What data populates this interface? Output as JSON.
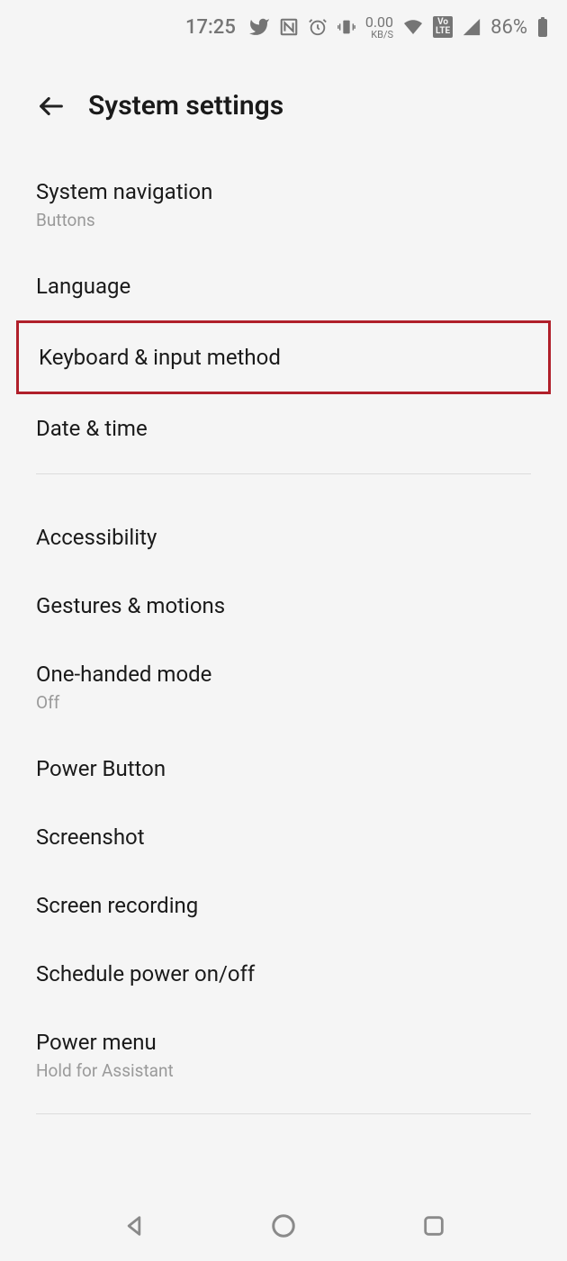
{
  "status": {
    "time": "17:25",
    "data_rate": "0.00",
    "data_unit": "KB/S",
    "battery_pct": "86%",
    "volte": "Vo\nLTE"
  },
  "header": {
    "title": "System settings"
  },
  "items": [
    {
      "title": "System navigation",
      "sub": "Buttons",
      "highlight": false
    },
    {
      "title": "Language",
      "sub": null,
      "highlight": false
    },
    {
      "title": "Keyboard & input method",
      "sub": null,
      "highlight": true
    },
    {
      "title": "Date & time",
      "sub": null,
      "highlight": false
    }
  ],
  "items2": [
    {
      "title": "Accessibility",
      "sub": null
    },
    {
      "title": "Gestures & motions",
      "sub": null
    },
    {
      "title": "One-handed mode",
      "sub": "Off"
    },
    {
      "title": "Power Button",
      "sub": null
    },
    {
      "title": "Screenshot",
      "sub": null
    },
    {
      "title": "Screen recording",
      "sub": null
    },
    {
      "title": "Schedule power on/off",
      "sub": null
    },
    {
      "title": "Power menu",
      "sub": "Hold for Assistant"
    }
  ]
}
